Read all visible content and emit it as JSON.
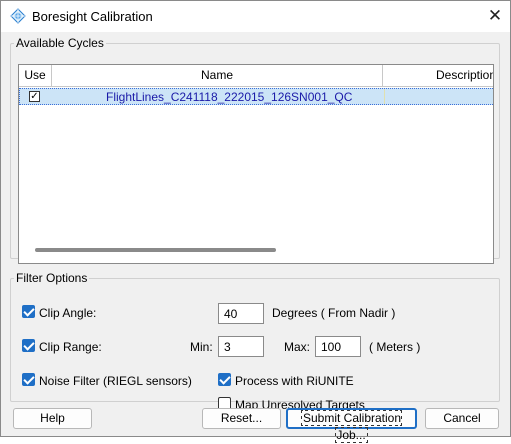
{
  "window": {
    "title": "Boresight Calibration",
    "close_glyph": "✕",
    "icon": "app-diamond-icon"
  },
  "cycles": {
    "legend": "Available Cycles",
    "columns": {
      "use": "Use",
      "name": "Name",
      "description": "Description"
    },
    "rows": [
      {
        "use": true,
        "name": "FlightLines_C241118_222015_126SN001_QC",
        "description": ""
      }
    ]
  },
  "filter": {
    "legend": "Filter Options",
    "clip_angle": {
      "label": "Clip Angle:",
      "checked": true,
      "value": "40",
      "unit": "Degrees ( From Nadir )"
    },
    "clip_range": {
      "label": "Clip Range:",
      "checked": true,
      "min_label": "Min:",
      "min": "3",
      "max_label": "Max:",
      "max": "100",
      "unit": "( Meters )"
    },
    "noise_filter": {
      "label": "Noise Filter (RIEGL sensors)",
      "checked": true
    },
    "process_riunite": {
      "label": "Process with RiUNITE",
      "checked": true
    },
    "map_unresolved": {
      "label": "Map Unresolved Targets",
      "checked": false
    }
  },
  "buttons": {
    "help": "Help",
    "reset": "Reset...",
    "submit": "Submit Calibration Job...",
    "cancel": "Cancel"
  },
  "colors": {
    "accent": "#1f6fc6",
    "selection": "#cce4f7",
    "row_text": "#1a1aa8"
  }
}
